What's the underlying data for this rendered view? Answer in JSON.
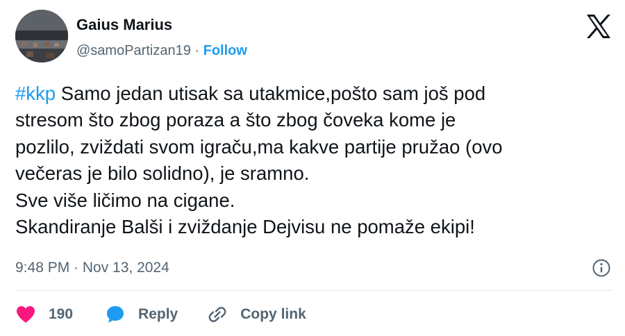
{
  "author": {
    "display_name": "Gaius Marius",
    "handle": "@samoPartizan19",
    "separator": " · ",
    "follow_label": "Follow"
  },
  "tweet": {
    "hashtag": "#kkp",
    "text": " Samo jedan utisak sa utakmice,pošto sam još pod\nstresom što zbog poraza a što zbog čoveka kome je\npozlilo, zviždati svom igraču,ma kakve partije pružao (ovo\nvečeras je bilo solidno), je sramno.\nSve više ličimo na cigane.\nSkandiranje Balši i zviždanje Dejvisu ne pomaže ekipi!",
    "timestamp": "9:48 PM · Nov 13, 2024"
  },
  "actions": {
    "like_count": "190",
    "reply_label": "Reply",
    "copy_link_label": "Copy link"
  },
  "icons": {
    "platform_logo": "x-logo-icon",
    "info": "info-icon",
    "like": "heart-icon",
    "reply": "speech-bubble-icon",
    "copy_link": "link-icon"
  },
  "colors": {
    "text": "#0f1419",
    "secondary": "#536471",
    "accent": "#1d9bf0",
    "like": "#f91880",
    "divider": "#e1e8ed"
  }
}
